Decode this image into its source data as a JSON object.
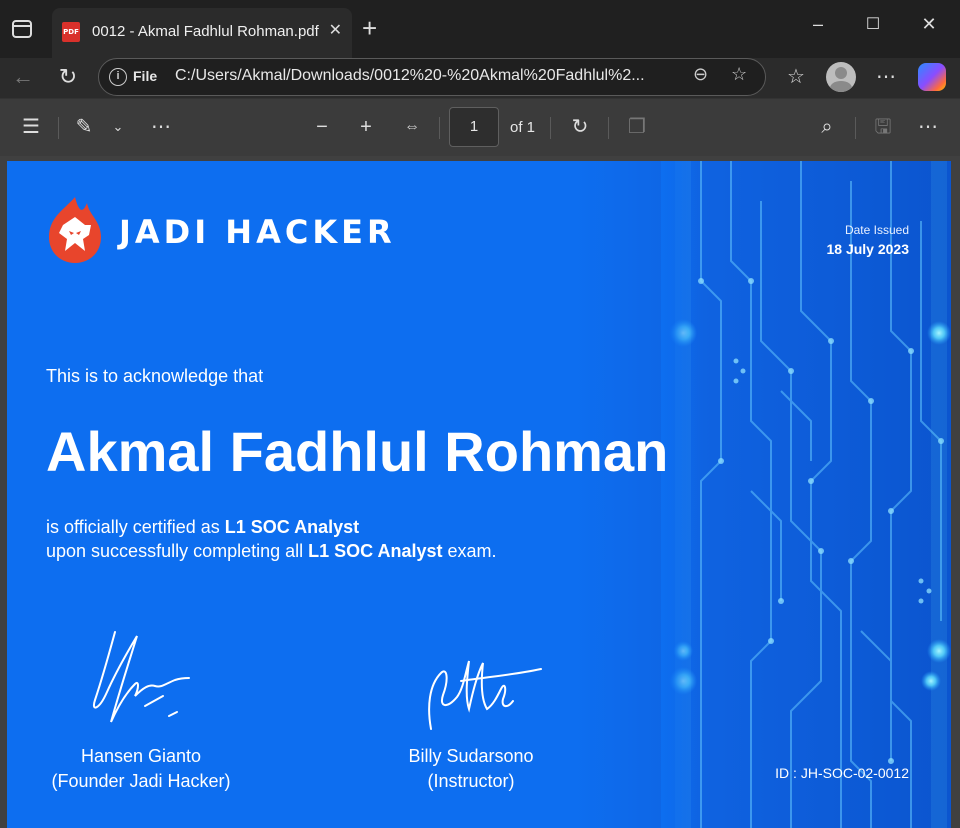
{
  "browser": {
    "tab_title": "0012 - Akmal Fadhlul Rohman.pdf",
    "tab_icon_text": "PDF",
    "address_scheme_label": "File",
    "url": "C:/Users/Akmal/Downloads/0012%20-%20Akmal%20Fadhlul%2...",
    "icons": [
      "sidebar-icon",
      "close-icon",
      "new-tab-icon",
      "minimize-icon",
      "maximize-icon",
      "window-close-icon",
      "back-icon",
      "refresh-icon",
      "info-icon",
      "zoom-icon",
      "favorite-star-icon",
      "favorites-icon",
      "profile-avatar",
      "more-icon",
      "copilot-icon"
    ]
  },
  "pdf_toolbar": {
    "page_current": "1",
    "page_total_label": "of 1",
    "icons": [
      "contents-icon",
      "draw-icon",
      "chevron-down-icon",
      "more-icon",
      "zoom-out-icon",
      "zoom-in-icon",
      "fit-width-icon",
      "rotate-icon",
      "two-page-icon",
      "search-icon",
      "save-icon",
      "more-icon"
    ]
  },
  "certificate": {
    "brand": "JADI HACKER",
    "date_label": "Date Issued",
    "date_value": "18 July 2023",
    "acknowledge": "This is to acknowledge that",
    "recipient": "Akmal Fadhlul Rohman",
    "line1_prefix": "is officially certified as ",
    "line1_bold": "L1 SOC Analyst",
    "line2_prefix": "upon successfully completing all ",
    "line2_bold": "L1 SOC Analyst",
    "line2_suffix": " exam.",
    "signer1_name": "Hansen Gianto",
    "signer1_role": "(Founder Jadi Hacker)",
    "signer2_name": "Billy Sudarsono",
    "signer2_role": "(Instructor)",
    "certificate_id": "ID : JH-SOC-02-0012",
    "colors": {
      "background": "#0d6ef0",
      "logo": "#e8452c",
      "text": "#ffffff",
      "circuit": "#6fd6ff"
    }
  }
}
